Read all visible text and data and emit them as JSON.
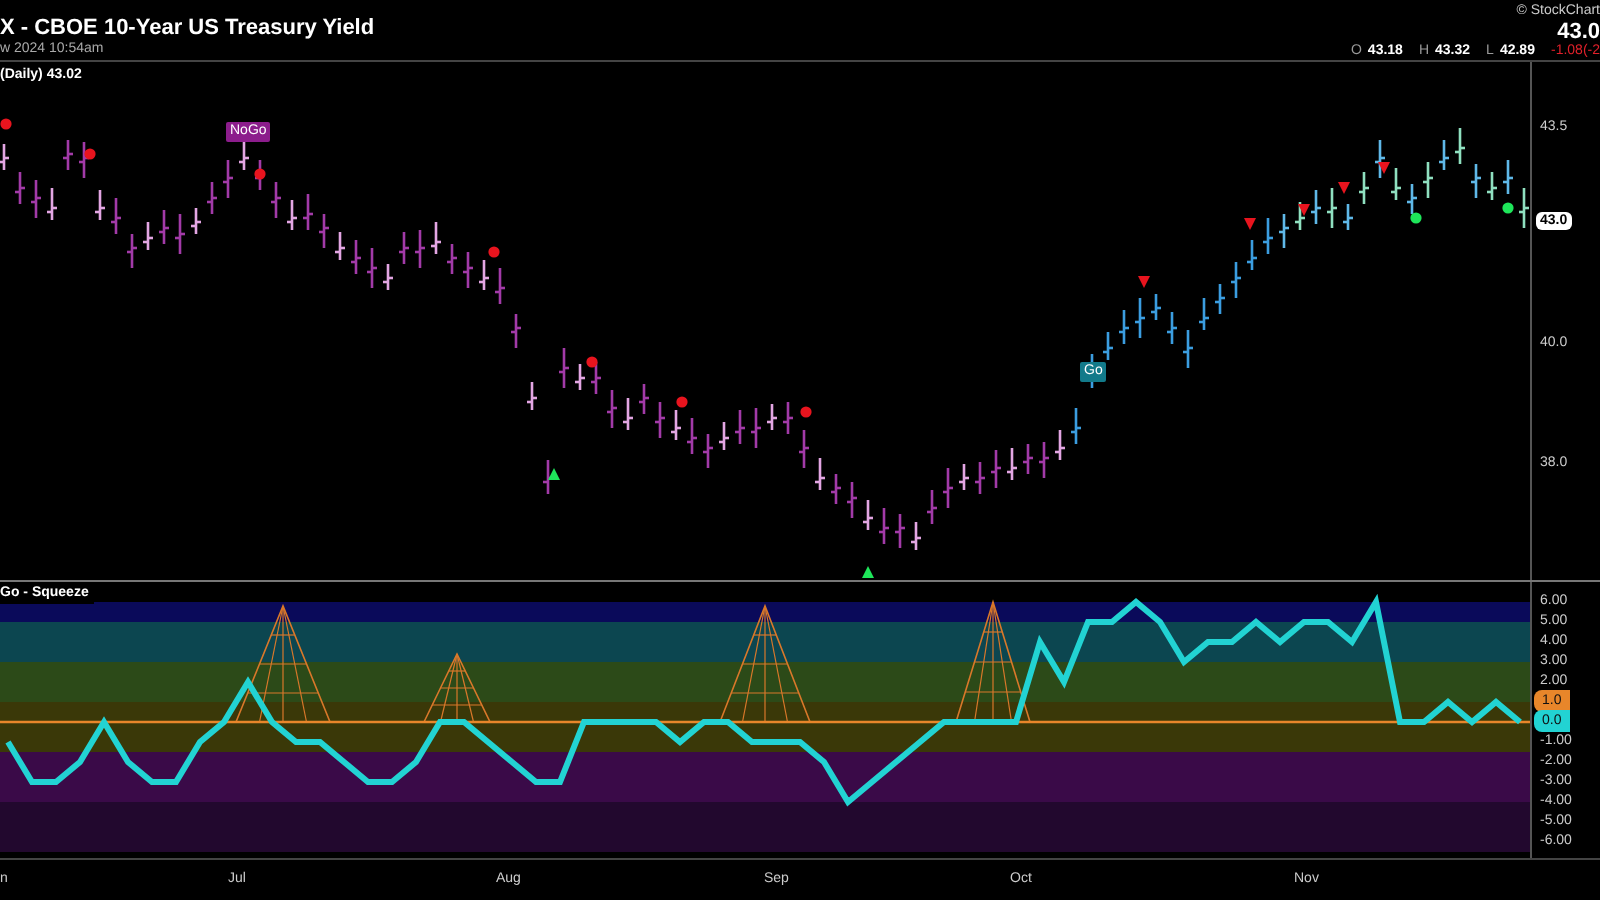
{
  "header": {
    "title": "X - CBOE 10-Year US Treasury Yield",
    "timestamp": "w 2024 10:54am",
    "copyright": "© StockChart",
    "last_price": "43.0",
    "ohlc": [
      {
        "label": "O",
        "value": "43.18"
      },
      {
        "label": "H",
        "value": "43.32"
      },
      {
        "label": "L",
        "value": "42.89"
      }
    ],
    "change": "-1.08(-2"
  },
  "price_panel": {
    "legend": "(Daily) 43.02",
    "signals": [
      {
        "kind": "nogo",
        "label": "NoGo"
      },
      {
        "kind": "go",
        "label": "Go"
      }
    ],
    "axis_labels": [
      "43.5",
      "40.0",
      "38.0"
    ],
    "price_badge": "43.0"
  },
  "oscillator_panel": {
    "legend": "Go - Squeeze",
    "badges": [
      {
        "label": "1.0",
        "color": "#e8862a"
      },
      {
        "label": "0.0",
        "color": "#22d3d3"
      }
    ],
    "axis_labels": [
      "6.00",
      "5.00",
      "4.00",
      "3.00",
      "2.00",
      "-1.00",
      "-2.00",
      "-3.00",
      "-4.00",
      "-5.00",
      "-6.00"
    ]
  },
  "x_axis": [
    "n",
    "Jul",
    "Aug",
    "Sep",
    "Oct",
    "Nov"
  ]
}
